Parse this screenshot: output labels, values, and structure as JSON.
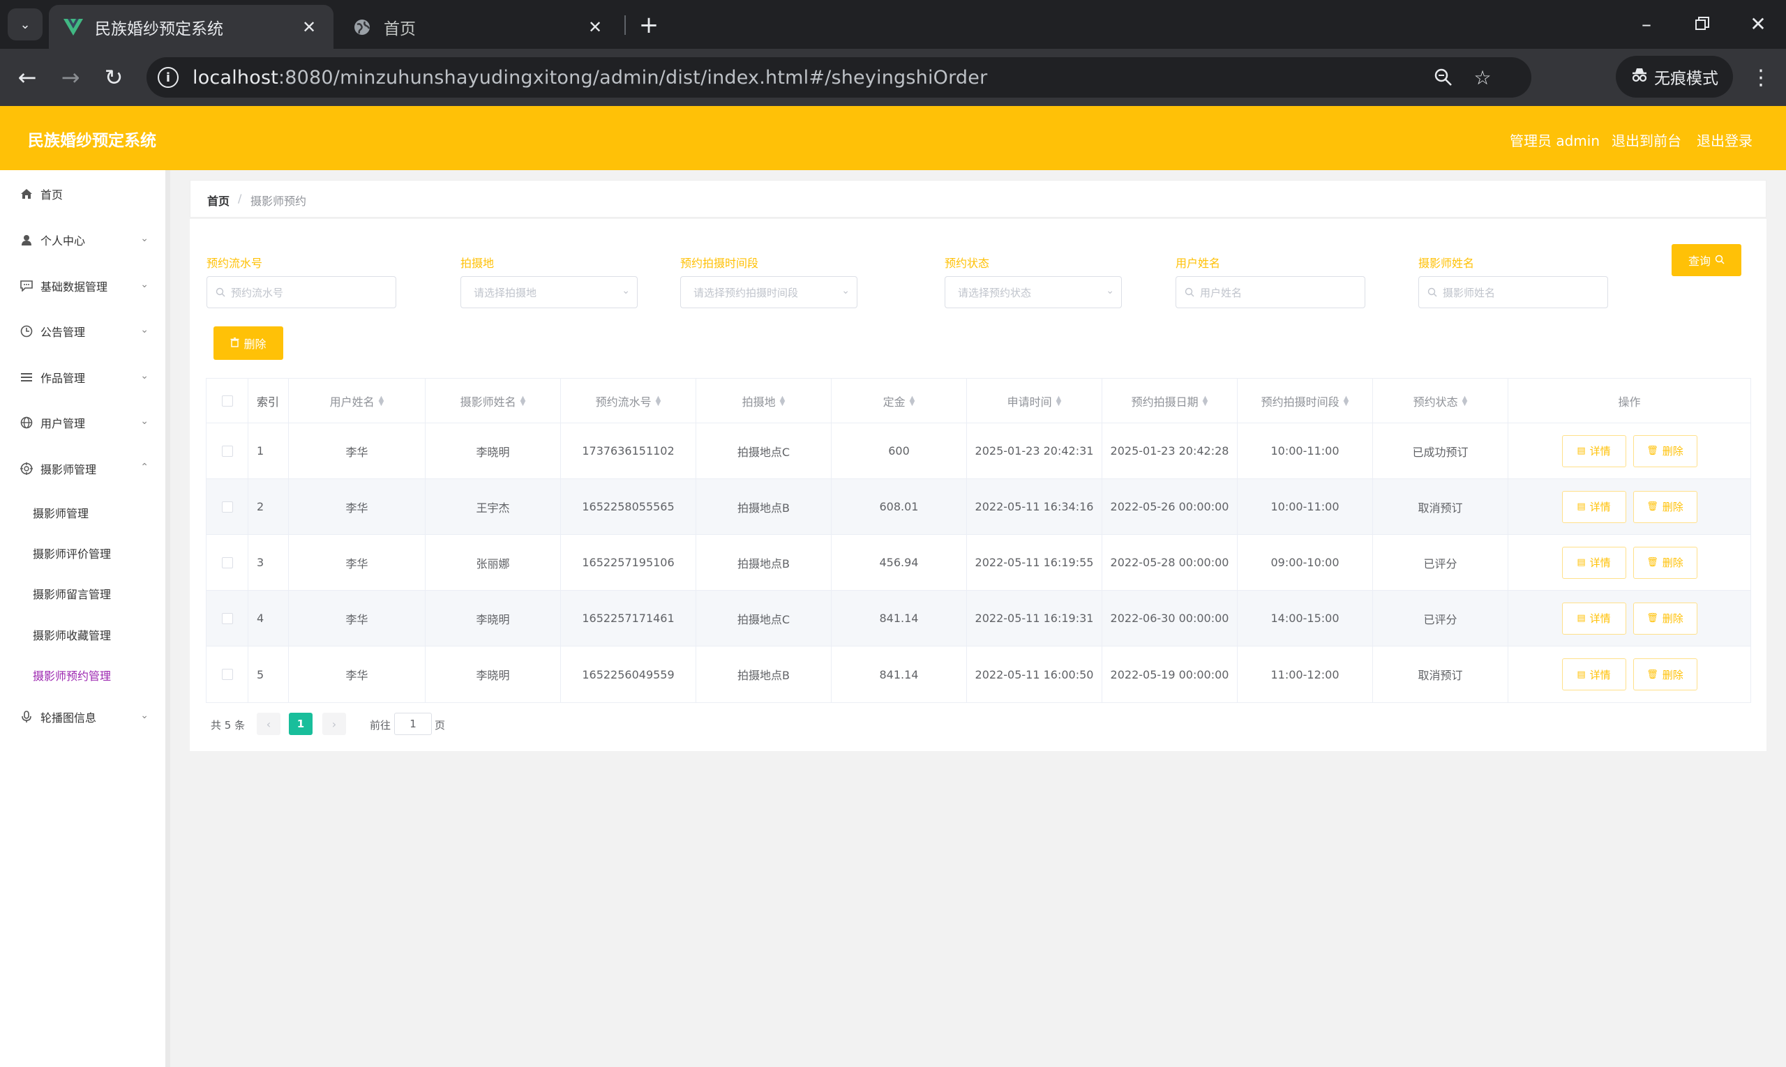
{
  "browser": {
    "active_tab_title": "民族婚纱预定系统",
    "inactive_tab_title": "首页",
    "url_host": "localhost",
    "url_path": ":8080/minzuhunshayudingxitong/admin/dist/index.html#/sheyingshiOrder",
    "incognito_label": "无痕模式"
  },
  "header": {
    "title": "民族婚纱预定系统",
    "admin_label": "管理员 admin",
    "to_front": "退出到前台",
    "logout": "退出登录",
    "color": "#ffc107"
  },
  "sidebar": {
    "items": [
      {
        "label": "首页",
        "icon": "home-icon"
      },
      {
        "label": "个人中心",
        "icon": "user-icon"
      },
      {
        "label": "基础数据管理",
        "icon": "chat-icon"
      },
      {
        "label": "公告管理",
        "icon": "clock-icon"
      },
      {
        "label": "作品管理",
        "icon": "list-icon"
      },
      {
        "label": "用户管理",
        "icon": "globe-icon"
      },
      {
        "label": "摄影师管理",
        "icon": "target-icon"
      },
      {
        "label": "轮播图信息",
        "icon": "mic-icon"
      }
    ],
    "sub_items": [
      "摄影师管理",
      "摄影师评价管理",
      "摄影师留言管理",
      "摄影师收藏管理",
      "摄影师预约管理"
    ],
    "active_color": "#9c27b0"
  },
  "breadcrumb": {
    "home": "首页",
    "separator": "/",
    "current": "摄影师预约"
  },
  "filters": {
    "order_no": {
      "label": "预约流水号",
      "placeholder": "预约流水号"
    },
    "location": {
      "label": "拍摄地",
      "placeholder": "请选择拍摄地"
    },
    "slot": {
      "label": "预约拍摄时间段",
      "placeholder": "请选择预约拍摄时间段"
    },
    "status": {
      "label": "预约状态",
      "placeholder": "请选择预约状态"
    },
    "user_name": {
      "label": "用户姓名",
      "placeholder": "用户姓名"
    },
    "photographer_name": {
      "label": "摄影师姓名",
      "placeholder": "摄影师姓名"
    },
    "query_button": "查询",
    "delete_button": "删除"
  },
  "table": {
    "headers": [
      "索引",
      "用户姓名",
      "摄影师姓名",
      "预约流水号",
      "拍摄地",
      "定金",
      "申请时间",
      "预约拍摄日期",
      "预约拍摄时间段",
      "预约状态",
      "操作"
    ],
    "detail_label": "详情",
    "delete_label": "删除",
    "rows": [
      [
        "1",
        "李华",
        "李晓明",
        "1737636151102",
        "拍摄地点C",
        "600",
        "2025-01-23 20:42:31",
        "2025-01-23 20:42:28",
        "10:00-11:00",
        "已成功预订"
      ],
      [
        "2",
        "李华",
        "王宇杰",
        "1652258055565",
        "拍摄地点B",
        "608.01",
        "2022-05-11 16:34:16",
        "2022-05-26 00:00:00",
        "10:00-11:00",
        "取消预订"
      ],
      [
        "3",
        "李华",
        "张丽娜",
        "1652257195106",
        "拍摄地点B",
        "456.94",
        "2022-05-11 16:19:55",
        "2022-05-28 00:00:00",
        "09:00-10:00",
        "已评分"
      ],
      [
        "4",
        "李华",
        "李晓明",
        "1652257171461",
        "拍摄地点C",
        "841.14",
        "2022-05-11 16:19:31",
        "2022-06-30 00:00:00",
        "14:00-15:00",
        "已评分"
      ],
      [
        "5",
        "李华",
        "李晓明",
        "1652256049559",
        "拍摄地点B",
        "841.14",
        "2022-05-11 16:00:50",
        "2022-05-19 00:00:00",
        "11:00-12:00",
        "取消预订"
      ]
    ]
  },
  "pagination": {
    "total": "共 5 条",
    "prev": "‹",
    "next": "›",
    "current_page": "1",
    "goto_label": "前往",
    "goto_value": "1",
    "page_suffix": "页"
  }
}
